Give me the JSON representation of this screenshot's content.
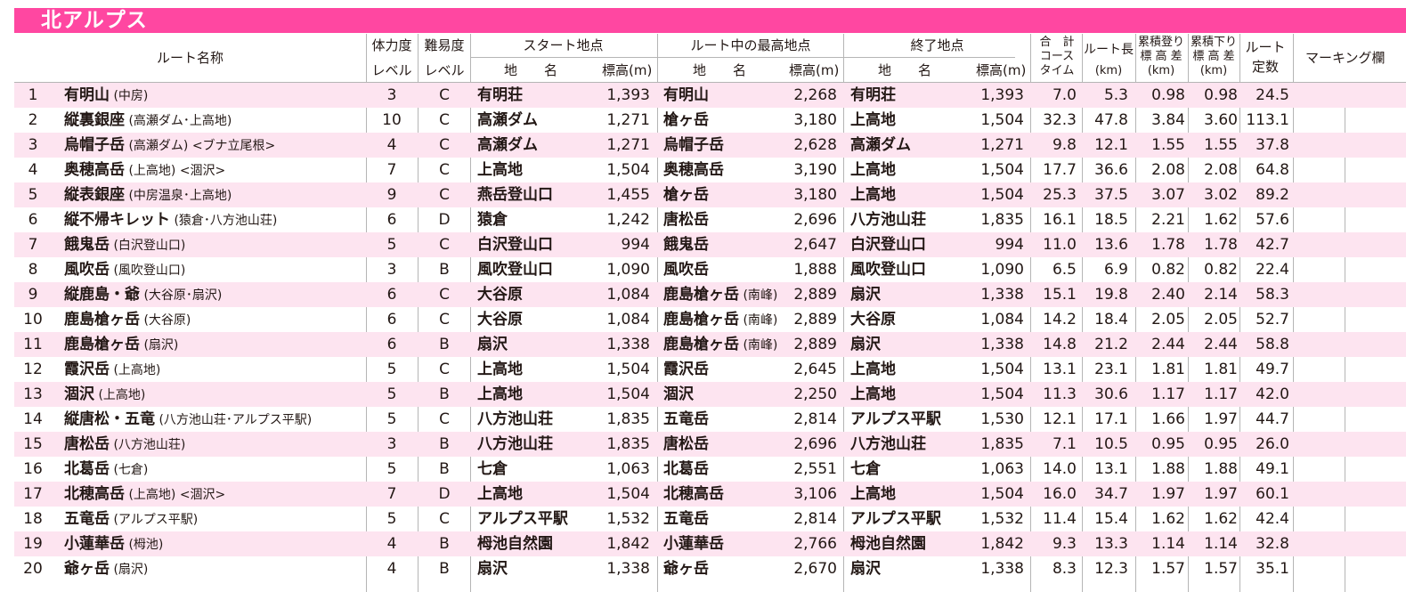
{
  "title": "北アルプス",
  "header": {
    "route_name": "ルート名称",
    "stamina": "体力度",
    "stamina_level": "レベル",
    "difficulty": "難易度",
    "difficulty_level": "レベル",
    "start": "スタート地点",
    "place_name": "地　　名",
    "elevation": "標高(m)",
    "highest": "ルート中の最高地点",
    "end": "終了地点",
    "total_time_1": "合　計",
    "total_time_2": "コース",
    "total_time_3": "タイム",
    "route_length_1": "ルート長",
    "route_length_2": "(km)",
    "ascent_1": "累積登り",
    "ascent_2": "標 高 差",
    "ascent_3": "(km)",
    "descent_1": "累積下り",
    "descent_2": "標 高 差",
    "descent_3": "(km)",
    "constant_1": "ルート",
    "constant_2": "定数",
    "marking": "マーキング欄"
  },
  "rows": [
    {
      "no": "1",
      "name": "有明山",
      "note": "(中房)",
      "stamina": "3",
      "difficulty": "C",
      "start": "有明荘",
      "start_elev": "1,393",
      "high": "有明山",
      "high_note": "",
      "high_elev": "2,268",
      "end": "有明荘",
      "end_elev": "1,393",
      "time": "7.0",
      "length": "5.3",
      "ascent": "0.98",
      "descent": "0.98",
      "constant": "24.5"
    },
    {
      "no": "2",
      "name": "縦裏銀座",
      "note": "(高瀬ダム･上高地)",
      "stamina": "10",
      "difficulty": "C",
      "start": "高瀬ダム",
      "start_elev": "1,271",
      "high": "槍ヶ岳",
      "high_note": "",
      "high_elev": "3,180",
      "end": "上高地",
      "end_elev": "1,504",
      "time": "32.3",
      "length": "47.8",
      "ascent": "3.84",
      "descent": "3.60",
      "constant": "113.1"
    },
    {
      "no": "3",
      "name": "烏帽子岳",
      "note": "(高瀬ダム) <ブナ立尾根>",
      "stamina": "4",
      "difficulty": "C",
      "start": "高瀬ダム",
      "start_elev": "1,271",
      "high": "烏帽子岳",
      "high_note": "",
      "high_elev": "2,628",
      "end": "高瀬ダム",
      "end_elev": "1,271",
      "time": "9.8",
      "length": "12.1",
      "ascent": "1.55",
      "descent": "1.55",
      "constant": "37.8"
    },
    {
      "no": "4",
      "name": "奥穂高岳",
      "note": "(上高地) <涸沢>",
      "stamina": "7",
      "difficulty": "C",
      "start": "上高地",
      "start_elev": "1,504",
      "high": "奥穂高岳",
      "high_note": "",
      "high_elev": "3,190",
      "end": "上高地",
      "end_elev": "1,504",
      "time": "17.7",
      "length": "36.6",
      "ascent": "2.08",
      "descent": "2.08",
      "constant": "64.8"
    },
    {
      "no": "5",
      "name": "縦表銀座",
      "note": "(中房温泉･上高地)",
      "stamina": "9",
      "difficulty": "C",
      "start": "燕岳登山口",
      "start_elev": "1,455",
      "high": "槍ヶ岳",
      "high_note": "",
      "high_elev": "3,180",
      "end": "上高地",
      "end_elev": "1,504",
      "time": "25.3",
      "length": "37.5",
      "ascent": "3.07",
      "descent": "3.02",
      "constant": "89.2"
    },
    {
      "no": "6",
      "name": "縦不帰キレット",
      "note": "(猿倉･八方池山荘)",
      "stamina": "6",
      "difficulty": "D",
      "start": "猿倉",
      "start_elev": "1,242",
      "high": "唐松岳",
      "high_note": "",
      "high_elev": "2,696",
      "end": "八方池山荘",
      "end_elev": "1,835",
      "time": "16.1",
      "length": "18.5",
      "ascent": "2.21",
      "descent": "1.62",
      "constant": "57.6"
    },
    {
      "no": "7",
      "name": "餓鬼岳",
      "note": "(白沢登山口)",
      "stamina": "5",
      "difficulty": "C",
      "start": "白沢登山口",
      "start_elev": "994",
      "high": "餓鬼岳",
      "high_note": "",
      "high_elev": "2,647",
      "end": "白沢登山口",
      "end_elev": "994",
      "time": "11.0",
      "length": "13.6",
      "ascent": "1.78",
      "descent": "1.78",
      "constant": "42.7"
    },
    {
      "no": "8",
      "name": "風吹岳",
      "note": "(風吹登山口)",
      "stamina": "3",
      "difficulty": "B",
      "start": "風吹登山口",
      "start_elev": "1,090",
      "high": "風吹岳",
      "high_note": "",
      "high_elev": "1,888",
      "end": "風吹登山口",
      "end_elev": "1,090",
      "time": "6.5",
      "length": "6.9",
      "ascent": "0.82",
      "descent": "0.82",
      "constant": "22.4"
    },
    {
      "no": "9",
      "name": "縦鹿島・爺",
      "note": "(大谷原･扇沢)",
      "stamina": "6",
      "difficulty": "C",
      "start": "大谷原",
      "start_elev": "1,084",
      "high": "鹿島槍ヶ岳",
      "high_note": "(南峰)",
      "high_elev": "2,889",
      "end": "扇沢",
      "end_elev": "1,338",
      "time": "15.1",
      "length": "19.8",
      "ascent": "2.40",
      "descent": "2.14",
      "constant": "58.3"
    },
    {
      "no": "10",
      "name": "鹿島槍ヶ岳",
      "note": "(大谷原)",
      "stamina": "6",
      "difficulty": "C",
      "start": "大谷原",
      "start_elev": "1,084",
      "high": "鹿島槍ヶ岳",
      "high_note": "(南峰)",
      "high_elev": "2,889",
      "end": "大谷原",
      "end_elev": "1,084",
      "time": "14.2",
      "length": "18.4",
      "ascent": "2.05",
      "descent": "2.05",
      "constant": "52.7"
    },
    {
      "no": "11",
      "name": "鹿島槍ヶ岳",
      "note": "(扇沢)",
      "stamina": "6",
      "difficulty": "B",
      "start": "扇沢",
      "start_elev": "1,338",
      "high": "鹿島槍ヶ岳",
      "high_note": "(南峰)",
      "high_elev": "2,889",
      "end": "扇沢",
      "end_elev": "1,338",
      "time": "14.8",
      "length": "21.2",
      "ascent": "2.44",
      "descent": "2.44",
      "constant": "58.8"
    },
    {
      "no": "12",
      "name": "霞沢岳",
      "note": "(上高地)",
      "stamina": "5",
      "difficulty": "C",
      "start": "上高地",
      "start_elev": "1,504",
      "high": "霞沢岳",
      "high_note": "",
      "high_elev": "2,645",
      "end": "上高地",
      "end_elev": "1,504",
      "time": "13.1",
      "length": "23.1",
      "ascent": "1.81",
      "descent": "1.81",
      "constant": "49.7"
    },
    {
      "no": "13",
      "name": "涸沢",
      "note": "(上高地)",
      "stamina": "5",
      "difficulty": "B",
      "start": "上高地",
      "start_elev": "1,504",
      "high": "涸沢",
      "high_note": "",
      "high_elev": "2,250",
      "end": "上高地",
      "end_elev": "1,504",
      "time": "11.3",
      "length": "30.6",
      "ascent": "1.17",
      "descent": "1.17",
      "constant": "42.0"
    },
    {
      "no": "14",
      "name": "縦唐松・五竜",
      "note": "(八方池山荘･アルプス平駅)",
      "stamina": "5",
      "difficulty": "C",
      "start": "八方池山荘",
      "start_elev": "1,835",
      "high": "五竜岳",
      "high_note": "",
      "high_elev": "2,814",
      "end": "アルプス平駅",
      "end_elev": "1,530",
      "time": "12.1",
      "length": "17.1",
      "ascent": "1.66",
      "descent": "1.97",
      "constant": "44.7"
    },
    {
      "no": "15",
      "name": "唐松岳",
      "note": "(八方池山荘)",
      "stamina": "3",
      "difficulty": "B",
      "start": "八方池山荘",
      "start_elev": "1,835",
      "high": "唐松岳",
      "high_note": "",
      "high_elev": "2,696",
      "end": "八方池山荘",
      "end_elev": "1,835",
      "time": "7.1",
      "length": "10.5",
      "ascent": "0.95",
      "descent": "0.95",
      "constant": "26.0"
    },
    {
      "no": "16",
      "name": "北葛岳",
      "note": "(七倉)",
      "stamina": "5",
      "difficulty": "B",
      "start": "七倉",
      "start_elev": "1,063",
      "high": "北葛岳",
      "high_note": "",
      "high_elev": "2,551",
      "end": "七倉",
      "end_elev": "1,063",
      "time": "14.0",
      "length": "13.1",
      "ascent": "1.88",
      "descent": "1.88",
      "constant": "49.1"
    },
    {
      "no": "17",
      "name": "北穂高岳",
      "note": "(上高地) <涸沢>",
      "stamina": "7",
      "difficulty": "D",
      "start": "上高地",
      "start_elev": "1,504",
      "high": "北穂高岳",
      "high_note": "",
      "high_elev": "3,106",
      "end": "上高地",
      "end_elev": "1,504",
      "time": "16.0",
      "length": "34.7",
      "ascent": "1.97",
      "descent": "1.97",
      "constant": "60.1"
    },
    {
      "no": "18",
      "name": "五竜岳",
      "note": "(アルプス平駅)",
      "stamina": "5",
      "difficulty": "C",
      "start": "アルプス平駅",
      "start_elev": "1,532",
      "high": "五竜岳",
      "high_note": "",
      "high_elev": "2,814",
      "end": "アルプス平駅",
      "end_elev": "1,532",
      "time": "11.4",
      "length": "15.4",
      "ascent": "1.62",
      "descent": "1.62",
      "constant": "42.4"
    },
    {
      "no": "19",
      "name": "小蓮華岳",
      "note": "(栂池)",
      "stamina": "4",
      "difficulty": "B",
      "start": "栂池自然園",
      "start_elev": "1,842",
      "high": "小蓮華岳",
      "high_note": "",
      "high_elev": "2,766",
      "end": "栂池自然園",
      "end_elev": "1,842",
      "time": "9.3",
      "length": "13.3",
      "ascent": "1.14",
      "descent": "1.14",
      "constant": "32.8"
    },
    {
      "no": "20",
      "name": "爺ヶ岳",
      "note": "(扇沢)",
      "stamina": "4",
      "difficulty": "B",
      "start": "扇沢",
      "start_elev": "1,338",
      "high": "爺ヶ岳",
      "high_note": "",
      "high_elev": "2,670",
      "end": "扇沢",
      "end_elev": "1,338",
      "time": "8.3",
      "length": "12.3",
      "ascent": "1.57",
      "descent": "1.57",
      "constant": "35.1"
    }
  ],
  "colors": {
    "banner": "#ff47a1",
    "row_alt": "#fde4f0",
    "grid": "#b5b5b5",
    "text": "#231815"
  }
}
